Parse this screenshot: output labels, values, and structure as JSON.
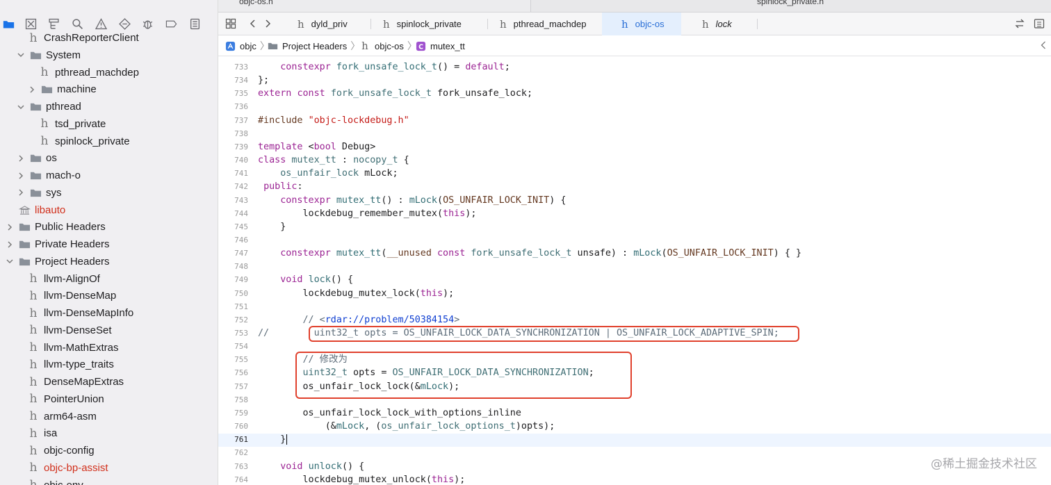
{
  "top_tabs": [
    "objc-os.h",
    "spinlock_private.h"
  ],
  "editor_tabs": [
    {
      "label": "dyld_priv",
      "active": false,
      "italic": false
    },
    {
      "label": "spinlock_private",
      "active": false,
      "italic": false
    },
    {
      "label": "pthread_machdep",
      "active": false,
      "italic": false
    },
    {
      "label": "objc-os",
      "active": true,
      "italic": false
    },
    {
      "label": "lock",
      "active": false,
      "italic": true
    }
  ],
  "breadcrumb": [
    "objc",
    "Project Headers",
    "objc-os",
    "mutex_tt"
  ],
  "sidebar": {
    "items": [
      {
        "label": "CrashReporterClient",
        "type": "header-file",
        "level": 2
      },
      {
        "label": "System",
        "type": "folder-open",
        "level": 1
      },
      {
        "label": "pthread_machdep",
        "type": "header-file",
        "level": 3
      },
      {
        "label": "machine",
        "type": "folder-closed",
        "level": 2
      },
      {
        "label": "pthread",
        "type": "folder-open",
        "level": 1
      },
      {
        "label": "tsd_private",
        "type": "header-file",
        "level": 3
      },
      {
        "label": "spinlock_private",
        "type": "header-file",
        "level": 3
      },
      {
        "label": "os",
        "type": "folder-closed",
        "level": 1
      },
      {
        "label": "mach-o",
        "type": "folder-closed",
        "level": 1
      },
      {
        "label": "sys",
        "type": "folder-closed",
        "level": 1
      },
      {
        "label": "libauto",
        "type": "library",
        "level": 1
      },
      {
        "label": "Public Headers",
        "type": "folder-closed",
        "level": 0
      },
      {
        "label": "Private Headers",
        "type": "folder-closed",
        "level": 0
      },
      {
        "label": "Project Headers",
        "type": "folder-open",
        "level": 0
      },
      {
        "label": "llvm-AlignOf",
        "type": "header-file",
        "level": 2
      },
      {
        "label": "llvm-DenseMap",
        "type": "header-file",
        "level": 2
      },
      {
        "label": "llvm-DenseMapInfo",
        "type": "header-file",
        "level": 2
      },
      {
        "label": "llvm-DenseSet",
        "type": "header-file",
        "level": 2
      },
      {
        "label": "llvm-MathExtras",
        "type": "header-file",
        "level": 2
      },
      {
        "label": "llvm-type_traits",
        "type": "header-file",
        "level": 2
      },
      {
        "label": "DenseMapExtras",
        "type": "header-file",
        "level": 2
      },
      {
        "label": "PointerUnion",
        "type": "header-file",
        "level": 2
      },
      {
        "label": "arm64-asm",
        "type": "header-file",
        "level": 2
      },
      {
        "label": "isa",
        "type": "header-file",
        "level": 2
      },
      {
        "label": "objc-config",
        "type": "header-file",
        "level": 2
      },
      {
        "label": "objc-bp-assist",
        "type": "header-file",
        "level": 2
      },
      {
        "label": "objc-env",
        "type": "header-file",
        "level": 2
      }
    ]
  },
  "code_lines": [
    {
      "n": "733",
      "html": "    <span class=\"kw\">constexpr</span> <span class=\"fn\">fork_unsafe_lock_t</span>() = <span class=\"kw\">default</span>;"
    },
    {
      "n": "734",
      "html": "};"
    },
    {
      "n": "735",
      "html": "<span class=\"kw\">extern</span> <span class=\"kw\">const</span> <span class=\"ty\">fork_unsafe_lock_t</span> fork_unsafe_lock;"
    },
    {
      "n": "736",
      "html": ""
    },
    {
      "n": "737",
      "html": "<span class=\"pp\">#include </span><span class=\"str\">\"objc-lockdebug.h\"</span>"
    },
    {
      "n": "738",
      "html": ""
    },
    {
      "n": "739",
      "html": "<span class=\"kw\">template</span> &lt;<span class=\"kw\">bool</span> Debug&gt;"
    },
    {
      "n": "740",
      "html": "<span class=\"kw\">class</span> <span class=\"ty\">mutex_tt</span> : <span class=\"ty\">nocopy_t</span> {"
    },
    {
      "n": "741",
      "html": "    <span class=\"ty\">os_unfair_lock</span> mLock;"
    },
    {
      "n": "742",
      "html": " <span class=\"kw\">public</span>:"
    },
    {
      "n": "743",
      "html": "    <span class=\"kw\">constexpr</span> <span class=\"fn\">mutex_tt</span>() : <span class=\"fn\">mLock</span>(<span class=\"mac\">OS_UNFAIR_LOCK_INIT</span>) {"
    },
    {
      "n": "744",
      "html": "        lockdebug_remember_mutex(<span class=\"kw\">this</span>);"
    },
    {
      "n": "745",
      "html": "    }"
    },
    {
      "n": "746",
      "html": ""
    },
    {
      "n": "747",
      "html": "    <span class=\"kw\">constexpr</span> <span class=\"fn\">mutex_tt</span>(<span class=\"mac\">__unused</span> <span class=\"kw\">const</span> <span class=\"ty\">fork_unsafe_lock_t</span> unsafe) : <span class=\"fn\">mLock</span>(<span class=\"mac\">OS_UNFAIR_LOCK_INIT</span>) { }"
    },
    {
      "n": "748",
      "html": ""
    },
    {
      "n": "749",
      "html": "    <span class=\"kw\">void</span> <span class=\"fn\">lock</span>() {"
    },
    {
      "n": "750",
      "html": "        lockdebug_mutex_lock(<span class=\"kw\">this</span>);"
    },
    {
      "n": "751",
      "html": ""
    },
    {
      "n": "752",
      "html": "        <span class=\"cm\">// &lt;</span><span class=\"lk\">rdar://problem/50384154</span><span class=\"cm\">&gt;</span>"
    },
    {
      "n": "753",
      "html": "<span class=\"cm\">//        uint32_t opts = OS_UNFAIR_LOCK_DATA_SYNCHRONIZATION | OS_UNFAIR_LOCK_ADAPTIVE_SPIN;</span>"
    },
    {
      "n": "754",
      "html": ""
    },
    {
      "n": "755",
      "html": "        <span class=\"cm\">// 修改为</span>"
    },
    {
      "n": "756",
      "html": "        <span class=\"ty\">uint32_t</span> opts = <span class=\"ty\">OS_UNFAIR_LOCK_DATA_SYNCHRONIZATION</span>;"
    },
    {
      "n": "757",
      "html": "        os_unfair_lock_lock(&amp;<span class=\"fn\">mLock</span>);"
    },
    {
      "n": "758",
      "html": ""
    },
    {
      "n": "759",
      "html": "        os_unfair_lock_lock_with_options_inline"
    },
    {
      "n": "760",
      "html": "            (&amp;<span class=\"fn\">mLock</span>, (<span class=\"ty\">os_unfair_lock_options_t</span>)opts);"
    },
    {
      "n": "761",
      "html": "    }<span class=\"caret\"></span>"
    },
    {
      "n": "762",
      "html": ""
    },
    {
      "n": "763",
      "html": "    <span class=\"kw\">void</span> <span class=\"fn\">unlock</span>() {"
    },
    {
      "n": "764",
      "html": "        lockdebug_mutex_unlock(<span class=\"kw\">this</span>);"
    }
  ],
  "current_line": "761",
  "watermark": "@稀土掘金技术社区",
  "colors": {
    "accent": "#1a73e8",
    "highlight_box": "#e0402c",
    "keyword": "#9b2393"
  }
}
